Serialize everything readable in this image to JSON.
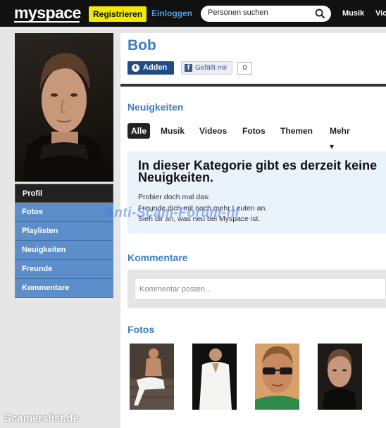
{
  "topbar": {
    "logo": "myspace",
    "register_label": "Registrieren",
    "login_label": "Einloggen",
    "search_placeholder": "Personen suchen",
    "nav": [
      "Musik",
      "Vic"
    ]
  },
  "sidebar": {
    "items": [
      {
        "label": "Profil"
      },
      {
        "label": "Fotos"
      },
      {
        "label": "Playlisten"
      },
      {
        "label": "Neuigkeiten"
      },
      {
        "label": "Freunde"
      },
      {
        "label": "Kommentare"
      }
    ]
  },
  "profile": {
    "name": "Bob",
    "add_label": "Adden",
    "like_label": "Gefällt mir",
    "like_count": "0"
  },
  "news": {
    "title": "Neuigkeiten",
    "tabs": [
      "Alle",
      "Musik",
      "Videos",
      "Fotos",
      "Themen",
      "Mehr ▾"
    ],
    "notice_title": "In dieser Kategorie gibt es derzeit keine Neuigkeiten.",
    "notice_lines": [
      "Probier doch mal das:",
      "Freunde dich mit noch mehr Leuten an.",
      "Sieh dir an, was neu bei Myspace ist."
    ]
  },
  "comments": {
    "title": "Kommentare",
    "placeholder": "Kommentar posten..."
  },
  "photos": {
    "title": "Fotos"
  },
  "watermark": "Anti-Scam-Forum-nl",
  "credit": "Scamerslist.de",
  "colors": {
    "brand_blue": "#3d7cc2",
    "sidebar_blue": "#5c8ec9",
    "register_yellow": "#f2e800",
    "topbar": "#111111"
  }
}
